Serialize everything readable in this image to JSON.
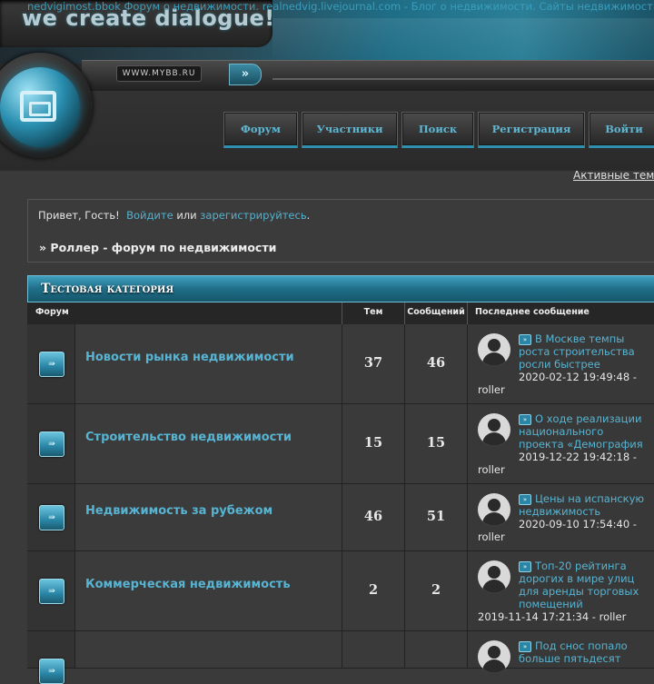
{
  "header": {
    "top_links": "nedvigimost.bbok Форум о недвижимости. realnedvig.livejournal.com - Блог о недвижимости. Сайты недвижимости.",
    "logo_text": "we create dialogue!",
    "url_box": "WWW.MYBB.RU",
    "go_arrow": "»",
    "nav": [
      "Форум",
      "Участники",
      "Поиск",
      "Регистрация",
      "Войти"
    ]
  },
  "active_topics": "Активные темы",
  "greeting": {
    "hello": "Привет, Гость!",
    "login": "Войдите",
    "or": "или",
    "register": "зарегистрируйтесь",
    "dot": "."
  },
  "breadcrumb": "» Роллер - форум по недвижимости",
  "category": {
    "title": "Тестовая категория",
    "columns": {
      "forum": "Форум",
      "topics": "Тем",
      "posts": "Сообщений",
      "last": "Последнее сообщение"
    }
  },
  "forums": [
    {
      "name": "Новости рынка недвижимости",
      "topics": "37",
      "posts": "46",
      "last_title": "В Москве темпы роста строительства росли быстрее",
      "last_date": "2020-02-12 19:49:48 -",
      "last_user": "roller"
    },
    {
      "name": "Строительство недвижимости",
      "topics": "15",
      "posts": "15",
      "last_title": "О ходе реализации национального проекта «Демография",
      "last_date": "2019-12-22 19:42:18 -",
      "last_user": "roller"
    },
    {
      "name": "Недвижимость за рубежом",
      "topics": "46",
      "posts": "51",
      "last_title": "Цены на испанскую недвижимость",
      "last_date": "2020-09-10 17:54:40 -",
      "last_user": "roller"
    },
    {
      "name": "Коммерческая недвижимость",
      "topics": "2",
      "posts": "2",
      "last_title": "Топ-20 рейтинга дорогих в мире улиц для аренды торговых помещений",
      "last_date": "2019-11-14 17:21:34 - roller",
      "last_user": ""
    },
    {
      "name": "",
      "topics": "",
      "posts": "",
      "last_title": "Под снос попало больше пятьдесят",
      "last_date": "",
      "last_user": ""
    }
  ]
}
